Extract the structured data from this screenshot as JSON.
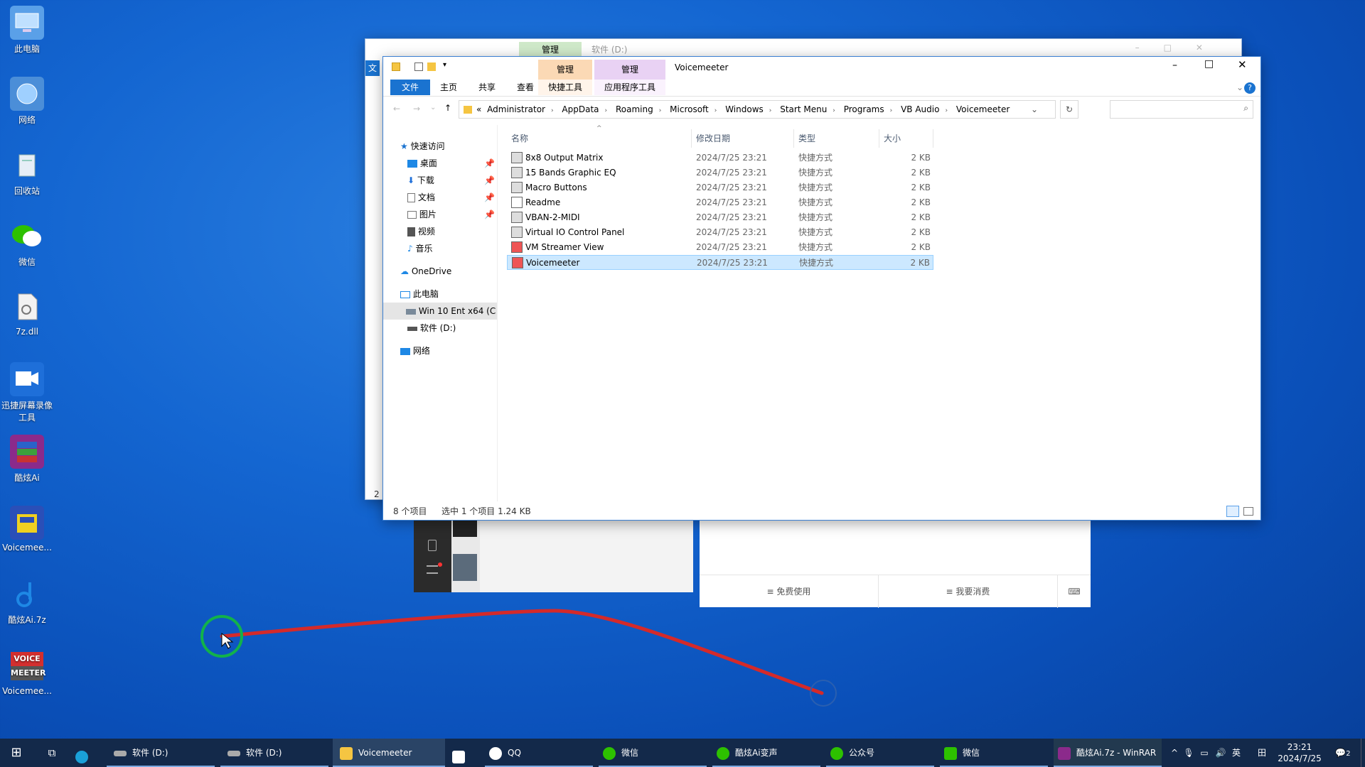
{
  "desktop": {
    "icons": [
      {
        "label": "此电脑",
        "icon": "computer-icon",
        "color": "#5aa0e8"
      },
      {
        "label": "网络",
        "icon": "network-icon",
        "color": "#4b8ed8"
      },
      {
        "label": "回收站",
        "icon": "recycle-bin-icon",
        "color": "#c9d6e6"
      },
      {
        "label": "微信",
        "icon": "wechat-icon",
        "color": "#2dc100"
      },
      {
        "label": "7z.dll",
        "icon": "dll-file-icon",
        "color": "#e8e8e8"
      },
      {
        "label": "迅捷屏幕录像工具",
        "icon": "screen-recorder-icon",
        "color": "#1e6fd9"
      },
      {
        "label": "酷炫Ai",
        "icon": "winrar-archive-icon",
        "color": "#8b2a8b"
      },
      {
        "label": "Voicemee...",
        "icon": "voicemeeter-setup-icon",
        "color": "#2a4fb8"
      },
      {
        "label": "酷炫Ai.7z",
        "icon": "music-note-icon",
        "color": "#1e88e5"
      },
      {
        "label": "Voicemee...",
        "icon": "voicemeeter-icon",
        "color": "#d32f2f"
      }
    ]
  },
  "back_window": {
    "title": "软件 (D:)",
    "manage_tab": "管理",
    "file_tab": "文",
    "status_count": "2"
  },
  "wechat_window": {
    "btn_free": "免费使用",
    "btn_consume": "我要消费"
  },
  "explorer": {
    "title": "Voicemeeter",
    "ctx_tab1_header": "管理",
    "ctx_tab1": "快捷工具",
    "ctx_tab2_header": "管理",
    "ctx_tab2": "应用程序工具",
    "tabs": [
      "文件",
      "主页",
      "共享",
      "查看"
    ],
    "breadcrumb": [
      "Administrator",
      "AppData",
      "Roaming",
      "Microsoft",
      "Windows",
      "Start Menu",
      "Programs",
      "VB Audio",
      "Voicemeeter"
    ],
    "breadcrumb_prefix": "«",
    "nav": {
      "quick_access": "快速访问",
      "desktop": "桌面",
      "downloads": "下载",
      "documents": "文档",
      "pictures": "图片",
      "videos": "视频",
      "music": "音乐",
      "onedrive": "OneDrive",
      "this_pc": "此电脑",
      "drive_c": "Win 10 Ent x64 (C",
      "drive_d": "软件 (D:)",
      "network": "网络"
    },
    "columns": [
      "名称",
      "修改日期",
      "类型",
      "大小"
    ],
    "files": [
      {
        "name": "8x8 Output Matrix",
        "date": "2024/7/25 23:21",
        "type": "快捷方式",
        "size": "2 KB"
      },
      {
        "name": "15 Bands Graphic EQ",
        "date": "2024/7/25 23:21",
        "type": "快捷方式",
        "size": "2 KB"
      },
      {
        "name": "Macro Buttons",
        "date": "2024/7/25 23:21",
        "type": "快捷方式",
        "size": "2 KB"
      },
      {
        "name": "Readme",
        "date": "2024/7/25 23:21",
        "type": "快捷方式",
        "size": "2 KB"
      },
      {
        "name": "VBAN-2-MIDI",
        "date": "2024/7/25 23:21",
        "type": "快捷方式",
        "size": "2 KB"
      },
      {
        "name": "Virtual IO Control Panel",
        "date": "2024/7/25 23:21",
        "type": "快捷方式",
        "size": "2 KB"
      },
      {
        "name": "VM Streamer View",
        "date": "2024/7/25 23:21",
        "type": "快捷方式",
        "size": "2 KB"
      },
      {
        "name": "Voicemeeter",
        "date": "2024/7/25 23:21",
        "type": "快捷方式",
        "size": "2 KB"
      }
    ],
    "selected_row": 7,
    "status_items": "8 个项目",
    "status_selected": "选中 1 个项目  1.24 KB"
  },
  "taskbar": {
    "items": [
      {
        "label": "软件 (D:)",
        "icon": "drive-icon"
      },
      {
        "label": "软件 (D:)",
        "icon": "drive-icon"
      },
      {
        "label": "Voicemeeter",
        "icon": "folder-icon"
      },
      {
        "label": "QQ",
        "icon": "qq-icon"
      },
      {
        "label": "微信",
        "icon": "wechat-icon"
      },
      {
        "label": "酷炫Ai变声",
        "icon": "wechat-icon"
      },
      {
        "label": "公众号",
        "icon": "wechat-icon"
      },
      {
        "label": "微信",
        "icon": "wechat-icon"
      },
      {
        "label": "酷炫Ai.7z - WinRAR",
        "icon": "winrar-icon"
      }
    ],
    "ime": "英",
    "time": "23:21",
    "date": "2024/7/25",
    "notif_count": "2"
  },
  "colors": {
    "accent": "#0078d7",
    "selected_row": "#cce8ff",
    "ctx_manage1": "#fbd9b5",
    "ctx_manage2": "#e9d2f4",
    "taskbar": "#13294a"
  }
}
